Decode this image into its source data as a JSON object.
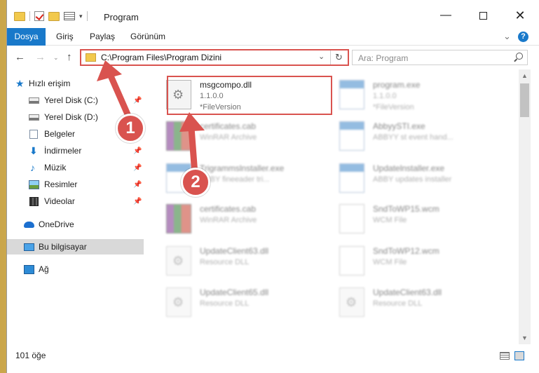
{
  "window": {
    "title": "Program",
    "minimize_glyph": "—",
    "maximize_glyph": "",
    "close_glyph": "✕"
  },
  "ribbon": {
    "tabs": [
      "Dosya",
      "Giriş",
      "Paylaş",
      "Görünüm"
    ],
    "help_label": "?"
  },
  "navigation": {
    "back_glyph": "←",
    "forward_glyph": "→",
    "recent_glyph": "⌄",
    "up_glyph": "↑",
    "address": "C:\\Program Files\\Program Dizini",
    "search_placeholder": "Ara: Program"
  },
  "sidebar": {
    "quick_access": "Hızlı erişim",
    "items": [
      {
        "label": "Yerel Disk (C:)",
        "pinned": true,
        "icon": "drive-icon"
      },
      {
        "label": "Yerel Disk (D:)",
        "pinned": false,
        "icon": "drive-icon"
      },
      {
        "label": "Belgeler",
        "pinned": true,
        "icon": "documents-icon"
      },
      {
        "label": "İndirmeler",
        "pinned": true,
        "icon": "downloads-icon"
      },
      {
        "label": "Müzik",
        "pinned": true,
        "icon": "music-icon"
      },
      {
        "label": "Resimler",
        "pinned": true,
        "icon": "pictures-icon"
      },
      {
        "label": "Videolar",
        "pinned": true,
        "icon": "videos-icon"
      }
    ],
    "onedrive": "OneDrive",
    "this_pc": "Bu bilgisayar",
    "network": "Ağ"
  },
  "files": [
    {
      "name": "msgcompo.dll",
      "line2": "1.1.0.0",
      "line3": "*FileVersion",
      "icon": "dll-icon",
      "highlighted": true
    },
    {
      "name": "program.exe",
      "line2": "1.1.0.0",
      "line3": "*FileVersion",
      "icon": "exe-icon"
    },
    {
      "name": "certificates.cab",
      "line2": "WinRAR Archive",
      "line3": "",
      "icon": "cab-icon"
    },
    {
      "name": "AbbyySTI.exe",
      "line2": "ABBYY st event hand...",
      "line3": "",
      "icon": "exe-icon"
    },
    {
      "name": "Trigrammslnstaller.exe",
      "line2": "ABBY fineeader tri...",
      "line3": "",
      "icon": "exe-icon"
    },
    {
      "name": "Updatelnstaller.exe",
      "line2": "ABBY updates installer",
      "line3": "",
      "icon": "exe-icon"
    },
    {
      "name": "certificates.cab",
      "line2": "WinRAR Archive",
      "line3": "",
      "icon": "cab-icon"
    },
    {
      "name": "SndToWP15.wcm",
      "line2": "WCM File",
      "line3": "",
      "icon": "wcm-icon"
    },
    {
      "name": "UpdateClient63.dll",
      "line2": "Resource DLL",
      "line3": "",
      "icon": "dll-icon"
    },
    {
      "name": "SndToWP12.wcm",
      "line2": "WCM File",
      "line3": "",
      "icon": "wcm-icon"
    },
    {
      "name": "UpdateClient65.dll",
      "line2": "Resource DLL",
      "line3": "",
      "icon": "dll-icon"
    },
    {
      "name": "UpdateClient63.dll",
      "line2": "Resource DLL",
      "line3": "",
      "icon": "dll-icon"
    }
  ],
  "status": {
    "item_count": "101 öğe"
  },
  "annotations": [
    {
      "number": "1"
    },
    {
      "number": "2"
    }
  ],
  "colors": {
    "accent": "#1979ca",
    "annotation": "#d9534f"
  }
}
